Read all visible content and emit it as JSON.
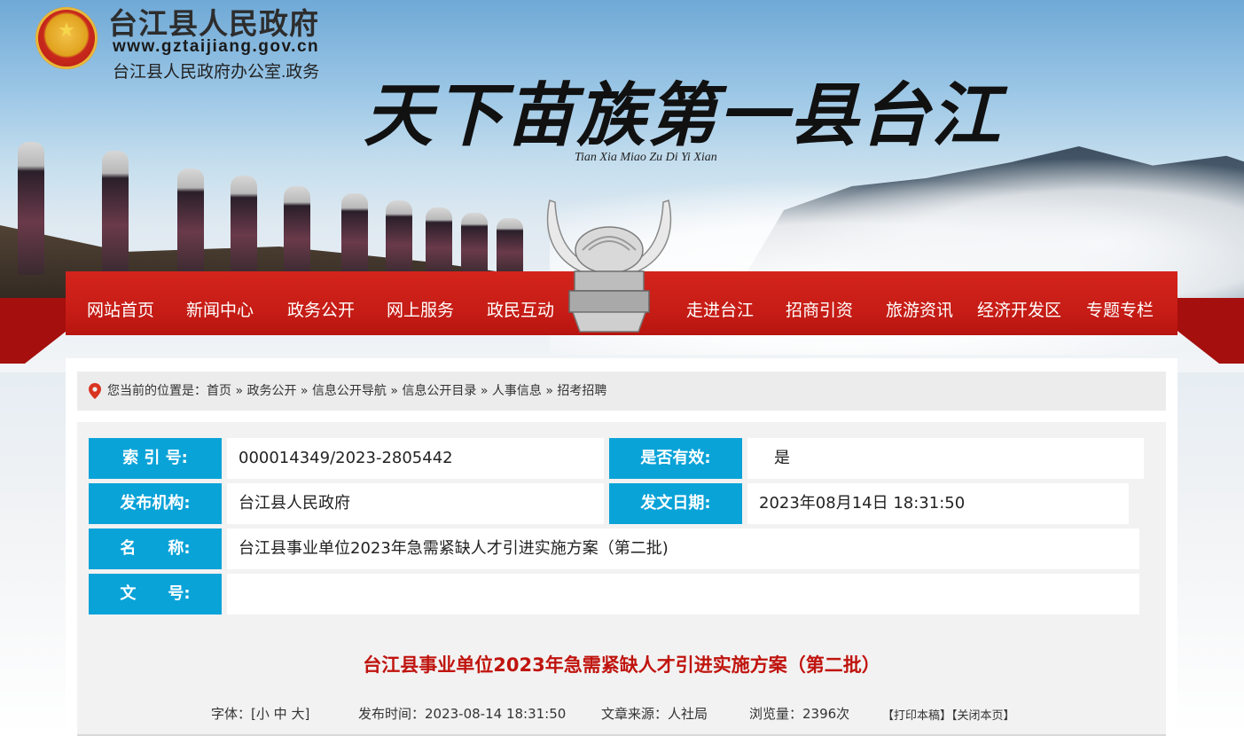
{
  "header": {
    "site_title": "台江县人民政府",
    "site_url": "www.gztaijiang.gov.cn",
    "site_office": "台江县人民政府办公室.政务",
    "slogan": "天下苗族第一县台江",
    "slogan_pinyin": "Tian Xia Miao Zu Di Yi Xian"
  },
  "nav": {
    "items": [
      {
        "label": "网站首页"
      },
      {
        "label": "新闻中心"
      },
      {
        "label": "政务公开"
      },
      {
        "label": "网上服务"
      },
      {
        "label": "政民互动"
      },
      {
        "label": "走进台江"
      },
      {
        "label": "招商引资"
      },
      {
        "label": "旅游资讯"
      },
      {
        "label": "经济开发区"
      },
      {
        "label": "专题专栏"
      }
    ]
  },
  "breadcrumb": {
    "prefix": "您当前的位置是：",
    "items": [
      {
        "label": "首页"
      },
      {
        "label": "政务公开"
      },
      {
        "label": "信息公开导航"
      },
      {
        "label": "信息公开目录"
      },
      {
        "label": "人事信息"
      },
      {
        "label": "招考招聘"
      }
    ],
    "separator": " » "
  },
  "meta": {
    "index_label": "索 引 号:",
    "index_value": "000014349/2023-2805442",
    "valid_label": "是否有效:",
    "valid_value": "是",
    "org_label": "发布机构:",
    "org_value": "台江县人民政府",
    "date_label": "发文日期:",
    "date_value": "2023年08月14日 18:31:50",
    "name_label": "名　　称:",
    "name_value": "台江县事业单位2023年急需紧缺人才引进实施方案（第二批)",
    "docno_label": "文　　号:",
    "docno_value": ""
  },
  "article": {
    "title": "台江县事业单位2023年急需紧缺人才引进实施方案（第二批）",
    "font_label": "字体：[",
    "font_small": "小",
    "font_medium": "中",
    "font_large": "大",
    "font_close": "]",
    "publish_time": "发布时间：2023-08-14 18:31:50",
    "source": "文章来源：人社局",
    "views": "浏览量：2396次",
    "print_label": "【打印本稿】",
    "close_label": "【关闭本页】"
  },
  "colors": {
    "nav_red": "#c71d16",
    "label_blue": "#0aa3d8",
    "title_red": "#c0140e"
  }
}
